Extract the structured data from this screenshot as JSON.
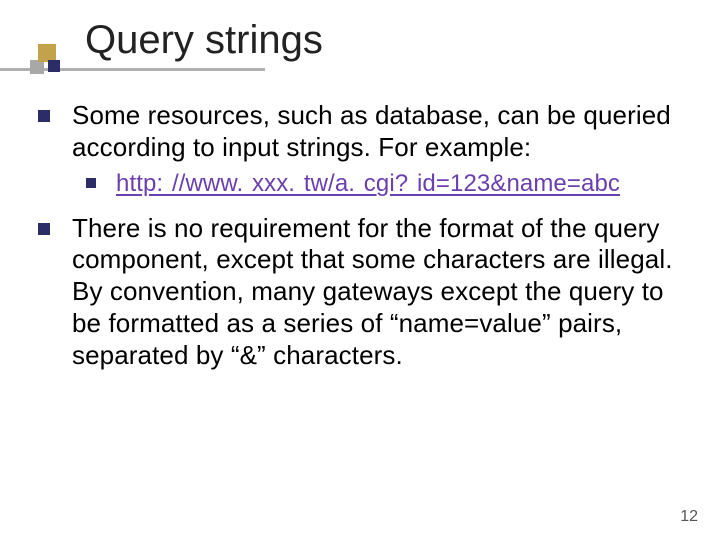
{
  "title": "Query strings",
  "bullets": {
    "b1": "Some resources, such as database, can be queried according to input strings. For example:",
    "sub_url_prefix": "http: //www. xxx. tw/a. cgi? ",
    "sub_url_qs": "id=123&name=abc",
    "b2": "There is no requirement for the format of the query component, except that some characters are illegal. By convention, many gateways except the query to be formatted as a series of “name=value” pairs, separated by “&” characters."
  },
  "page_number": "12"
}
